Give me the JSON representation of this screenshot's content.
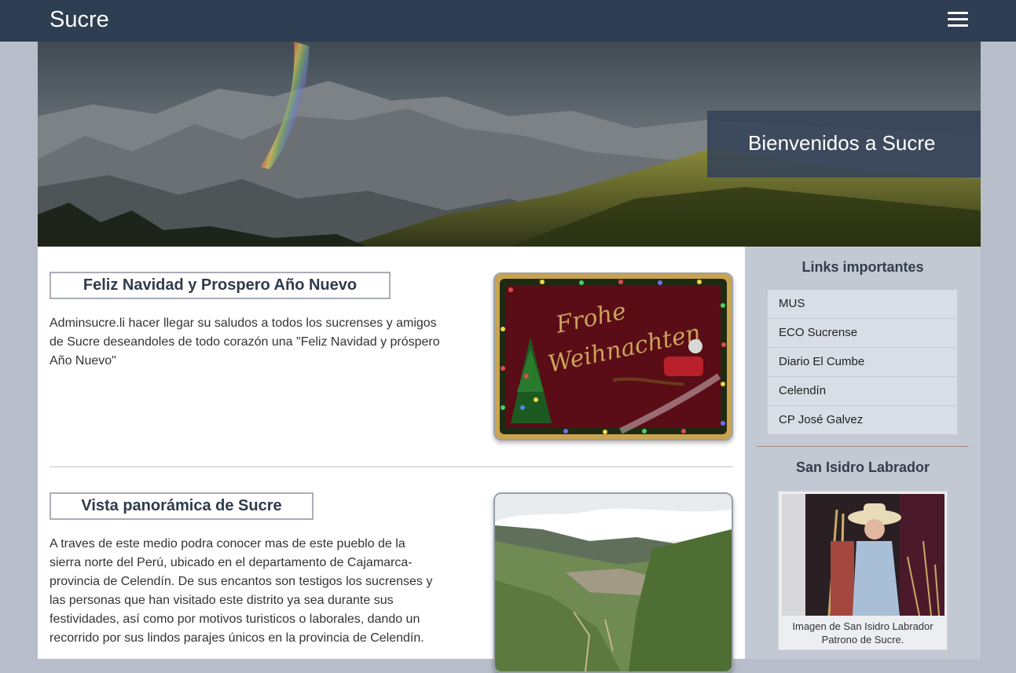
{
  "header": {
    "title": "Sucre",
    "menu_icon": "hamburger-menu-icon"
  },
  "hero": {
    "banner_text": "Bienvenidos a Sucre"
  },
  "posts": [
    {
      "title": "Feliz Navidad y Prospero Año Nuevo",
      "lines": [
        "Adminsucre.li hacer llegar su saludos a todos los sucrenses y amigos",
        "de Sucre deseandoles de todo corazón una \"Feliz Navidad y próspero",
        "Año Nuevo\""
      ],
      "image_text": [
        "Frohe",
        "Weihnachten"
      ]
    },
    {
      "title": "Vista panorámica de Sucre",
      "lines": [
        "A traves de este medio podra conocer mas de este pueblo de la",
        "sierra norte del Perú, ubicado en el departamento de Cajamarca-",
        "provincia de Celendín. De sus encantos son testigos los sucrenses y",
        "las personas que han visitado este distrito ya sea durante sus",
        "festividades, así como por motivos turisticos o laborales, dando un",
        "recorrido por sus lindos parajes únicos en la provincia de Celendín."
      ]
    }
  ],
  "sidebar": {
    "links_heading": "Links importantes",
    "links": [
      "MUS",
      "ECO Sucrense",
      "Diario El Cumbe",
      "Celendín",
      "CP José Galvez"
    ],
    "saint_heading": "San Isidro Labrador",
    "caption_lines": [
      "Imagen de San Isidro Labrador",
      "Patrono de Sucre."
    ]
  },
  "colors": {
    "header_bg": "#2e3e52",
    "page_bg": "#b7bec9",
    "sidebar_bg": "#c3c9d3",
    "link_bg": "#d9dde5"
  }
}
